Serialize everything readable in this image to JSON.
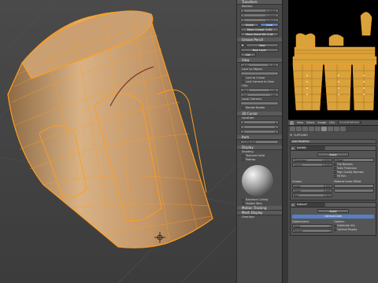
{
  "npanel": {
    "transform_header": "Transform",
    "median_label": "Median:",
    "median_x": {
      "label": "X:",
      "value": "0.00000"
    },
    "median_y": {
      "label": "Y:",
      "value": "0.00000"
    },
    "median_z": {
      "label": "Z:",
      "value": "0.04213"
    },
    "global_btn": "Global",
    "local_btn": "Local",
    "mean_crease": "Mean Crease: 0.00",
    "mean_bevel": "Mean Bevel Wt: 0.00",
    "grease_header": "Grease Pencil",
    "new_btn": "New",
    "new_layer_btn": "New Layer",
    "del_btn": "Del",
    "view_header": "View",
    "lens": {
      "label": "Lens:",
      "value": "35.000"
    },
    "lock_object": "Lock to Object:",
    "lock_cursor": "Lock to Cursor",
    "lock_camera": "Lock Camera to View",
    "clip_label": "Clip:",
    "clip_start": {
      "label": "Start:",
      "value": "0.100"
    },
    "clip_end": {
      "label": "End:",
      "value": "1000"
    },
    "local_camera": "Local Camera:",
    "render_border": "Render Border",
    "cursor_header": "3D Cursor",
    "location_label": "Location:",
    "cur_x": {
      "label": "X:",
      "value": "0"
    },
    "cur_y": {
      "label": "Y:",
      "value": "0"
    },
    "cur_z": {
      "label": "Z:",
      "value": "0"
    },
    "item_header": "Item",
    "item_name": "CUPOLINO",
    "display_header": "Display",
    "shading_header": "Shading",
    "textured_solid": "Textured Solid",
    "matcap": "Matcap",
    "backface": "Backface Culling",
    "hidden_wire": "Hidden Wire",
    "motion_tracking": "Motion Tracking",
    "mesh_display": "Mesh Display",
    "overlays": "Overlays"
  },
  "uv_header": {
    "view": "View",
    "select": "Select",
    "image": "Image",
    "uvs": "UVs",
    "image_name": "SOLIDIFINP.000"
  },
  "modifiers": {
    "object_name": "CUPOLINO",
    "add_modifier": "Add Modifier",
    "mod1": {
      "name": "Solidify",
      "apply": "Apply",
      "thickness": {
        "label": "Thickness:",
        "value": "0.0001"
      },
      "clamp": {
        "label": "Clamp:",
        "value": "0.0000"
      },
      "offset": "Offset:",
      "flip_normals": "Flip Normals",
      "even_thickness": "Even Thickness",
      "high_quality": "High Quality Normals",
      "fill_rim": "Fill Rim",
      "crease_label": "Crease:",
      "inner": {
        "label": "Inner:",
        "value": "0.000"
      },
      "outer": {
        "label": "Outer:",
        "value": "0.000"
      },
      "rim": {
        "label": "Rim:",
        "value": "0.000"
      },
      "material_index": "Material Index Offset"
    },
    "mod2": {
      "name": "Subsurf",
      "apply": "Apply",
      "algorithm": "Catmull-Clark",
      "subdivisions": "Subdivisions:",
      "view": {
        "label": "View:",
        "value": "1"
      },
      "render": {
        "label": "Render:",
        "value": "2"
      },
      "options": "Options:",
      "subdivide_uvs": "Subdivide UVs",
      "optimal_display": "Optimal Display"
    }
  },
  "colors": {
    "mesh_fill": "#c9a070",
    "wire": "#ff9d1e",
    "selection_blue": "#5680c2"
  }
}
